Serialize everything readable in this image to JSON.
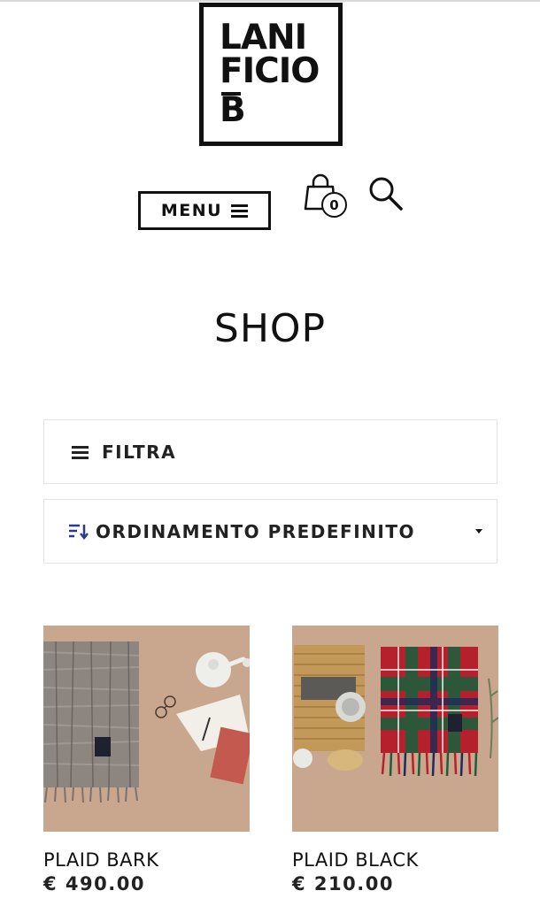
{
  "header": {
    "logo_lines": [
      "LANI",
      "FICIO",
      "B"
    ],
    "menu_label": "MENU",
    "cart_count": "0"
  },
  "page": {
    "title": "SHOP"
  },
  "toolbar": {
    "filter_label": "FILTRA",
    "sort_label": "ORDINAMENTO PREDEFINITO"
  },
  "products": [
    {
      "name": "PLAID BARK",
      "price": "€ 490.00"
    },
    {
      "name": "PLAID BLACK",
      "price": "€ 210.00"
    }
  ],
  "colors": {
    "text": "#111111",
    "sort_icon_accent": "#2b3a8c",
    "product_bg": "#c9a78e"
  },
  "icons": [
    "hamburger-icon",
    "shopping-bag-icon",
    "search-icon",
    "sort-icon",
    "caret-down-icon"
  ]
}
